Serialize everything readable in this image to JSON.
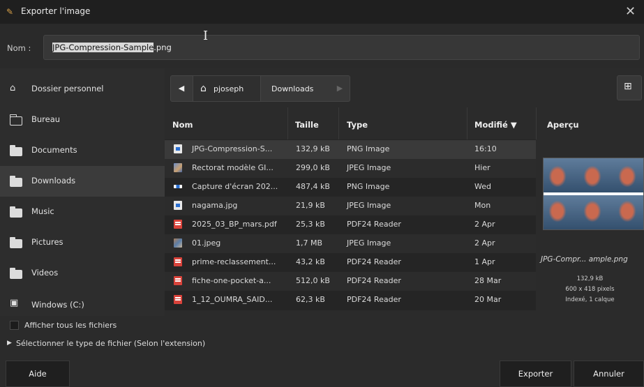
{
  "window": {
    "title": "Exporter l'image",
    "close_glyph": "✕",
    "app_icon": "gimp-icon"
  },
  "name_field": {
    "label": "Nom :",
    "selected_part": "JPG-Compression-Sample",
    "rest": ".png"
  },
  "sidebar": {
    "items": [
      {
        "label": "Dossier personnel",
        "icon": "home-icon"
      },
      {
        "label": "Bureau",
        "icon": "folder-outline-icon"
      },
      {
        "label": "Documents",
        "icon": "folder-icon"
      },
      {
        "label": "Downloads",
        "icon": "folder-icon",
        "active": true
      },
      {
        "label": "Music",
        "icon": "folder-icon"
      },
      {
        "label": "Pictures",
        "icon": "folder-icon"
      },
      {
        "label": "Videos",
        "icon": "folder-icon"
      },
      {
        "label": "Windows (C:)",
        "icon": "drive-icon"
      }
    ]
  },
  "pathbar": {
    "back": "◀",
    "home_label": "pjoseph",
    "current": "Downloads",
    "forward": "▶"
  },
  "file_list": {
    "columns": {
      "name": "Nom",
      "size": "Taille",
      "type": "Type",
      "modified": "Modifié ▼"
    },
    "rows": [
      {
        "name": "JPG-Compression-S...",
        "size": "132,9 kB",
        "type": "PNG Image",
        "modified": "16:10",
        "icon": "png"
      },
      {
        "name": "Rectorat modèle GI...",
        "size": "299,0 kB",
        "type": "JPEG Image",
        "modified": "Hier",
        "icon": "jpg"
      },
      {
        "name": "Capture d'écran 202...",
        "size": "487,4 kB",
        "type": "PNG Image",
        "modified": "Wed",
        "icon": "scr"
      },
      {
        "name": "nagama.jpg",
        "size": "21,9 kB",
        "type": "JPEG Image",
        "modified": "Mon",
        "icon": "png"
      },
      {
        "name": "2025_03_BP_mars.pdf",
        "size": "25,3 kB",
        "type": "PDF24 Reader",
        "modified": "2 Apr",
        "icon": "pdf"
      },
      {
        "name": "01.jpeg",
        "size": "1,7 MB",
        "type": "JPEG Image",
        "modified": "2 Apr",
        "icon": "mix"
      },
      {
        "name": "prime-reclassement...",
        "size": "43,2 kB",
        "type": "PDF24 Reader",
        "modified": "1 Apr",
        "icon": "pdf"
      },
      {
        "name": "fiche-one-pocket-a...",
        "size": "512,0 kB",
        "type": "PDF24 Reader",
        "modified": "28 Mar",
        "icon": "pdf"
      },
      {
        "name": "1_12_OUMRA_SAID...",
        "size": "62,3 kB",
        "type": "PDF24 Reader",
        "modified": "20 Mar",
        "icon": "pdf"
      }
    ]
  },
  "preview": {
    "title": "Aperçu",
    "filename": "JPG-Compr... ample.png",
    "size": "132,9 kB",
    "dimensions": "600 x 418 pixels",
    "info": "Indexé, 1 calque"
  },
  "options": {
    "show_all": "Afficher tous les fichiers",
    "file_type": "Sélectionner le type de fichier (Selon l'extension)"
  },
  "buttons": {
    "help": "Aide",
    "export": "Exporter",
    "cancel": "Annuler"
  }
}
